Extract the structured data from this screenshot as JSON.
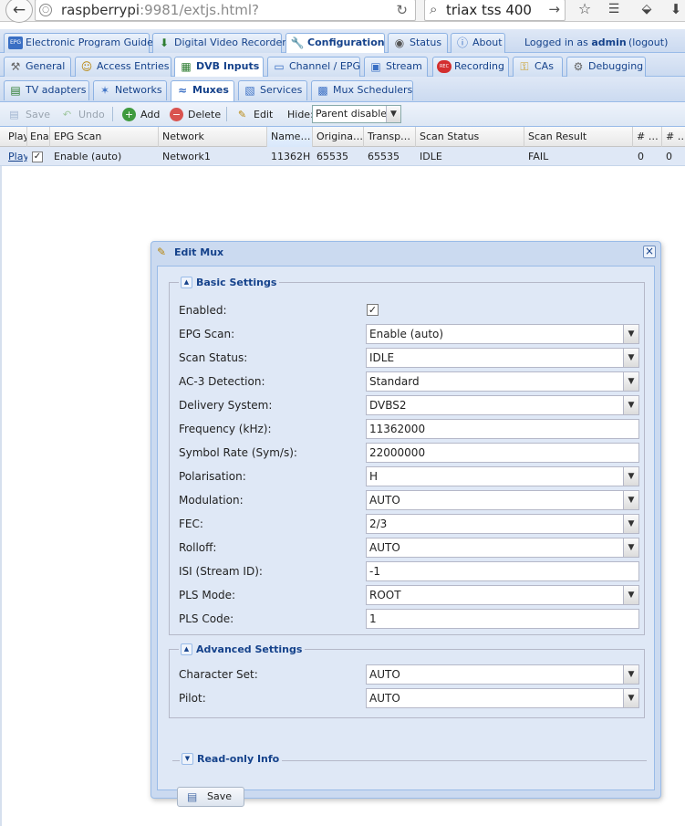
{
  "browser": {
    "url_host": "raspberrypi",
    "url_rest": ":9981/extjs.html?",
    "search_text": "triax tss 400"
  },
  "main_tabs": [
    {
      "label": "Electronic Program Guide",
      "icon": "epg-icon"
    },
    {
      "label": "Digital Video Recorder",
      "icon": "dvr-icon"
    },
    {
      "label": "Configuration",
      "icon": "wrench-icon",
      "active": true
    },
    {
      "label": "Status",
      "icon": "eye-icon"
    },
    {
      "label": "About",
      "icon": "info-icon"
    }
  ],
  "user": {
    "logged_in_prefix": "Logged in as",
    "username": "admin",
    "logout": "(logout)"
  },
  "config_tabs": [
    {
      "label": "General",
      "icon": "tools-icon"
    },
    {
      "label": "Access Entries",
      "icon": "users-icon"
    },
    {
      "label": "DVB Inputs",
      "icon": "card-icon",
      "active": true
    },
    {
      "label": "Channel / EPG",
      "icon": "tv-icon"
    },
    {
      "label": "Stream",
      "icon": "stream-icon"
    },
    {
      "label": "Recording",
      "icon": "rec-icon"
    },
    {
      "label": "CAs",
      "icon": "key-icon"
    },
    {
      "label": "Debugging",
      "icon": "debug-icon"
    }
  ],
  "dvb_tabs": [
    {
      "label": "TV adapters",
      "icon": "adapter-icon"
    },
    {
      "label": "Networks",
      "icon": "antenna-icon"
    },
    {
      "label": "Muxes",
      "icon": "mux-icon",
      "active": true
    },
    {
      "label": "Services",
      "icon": "services-icon"
    },
    {
      "label": "Mux Schedulers",
      "icon": "scheduler-icon"
    }
  ],
  "toolbar": {
    "save": "Save",
    "undo": "Undo",
    "add": "Add",
    "delete": "Delete",
    "edit": "Edit",
    "hide_label": "Hide:",
    "hide_value": "Parent disabled"
  },
  "grid": {
    "columns": [
      "Play",
      "Ena",
      "EPG Scan",
      "Network",
      "Name…",
      "Origina…",
      "Transp…",
      "Scan Status",
      "Scan Result",
      "# …",
      "# …"
    ],
    "row": {
      "play": "Play",
      "enabled": true,
      "epg_scan": "Enable (auto)",
      "network": "Network1",
      "name": "11362H",
      "original": "65535",
      "transport": "65535",
      "scan_status": "IDLE",
      "scan_result": "FAIL",
      "count1": "0",
      "count2": "0"
    }
  },
  "dialog": {
    "title": "Edit Mux",
    "basic_legend": "Basic Settings",
    "advanced_legend": "Advanced Settings",
    "readonly_legend": "Read-only Info",
    "save": "Save",
    "basic": [
      {
        "label": "Enabled:",
        "type": "checkbox",
        "checked": true
      },
      {
        "label": "EPG Scan:",
        "type": "combo",
        "value": "Enable (auto)"
      },
      {
        "label": "Scan Status:",
        "type": "combo",
        "value": "IDLE"
      },
      {
        "label": "AC-3 Detection:",
        "type": "combo",
        "value": "Standard"
      },
      {
        "label": "Delivery System:",
        "type": "combo",
        "value": "DVBS2"
      },
      {
        "label": "Frequency (kHz):",
        "type": "text",
        "value": "11362000"
      },
      {
        "label": "Symbol Rate (Sym/s):",
        "type": "text",
        "value": "22000000"
      },
      {
        "label": "Polarisation:",
        "type": "combo",
        "value": "H"
      },
      {
        "label": "Modulation:",
        "type": "combo",
        "value": "AUTO"
      },
      {
        "label": "FEC:",
        "type": "combo",
        "value": "2/3"
      },
      {
        "label": "Rolloff:",
        "type": "combo",
        "value": "AUTO"
      },
      {
        "label": "ISI (Stream ID):",
        "type": "text",
        "value": "-1"
      },
      {
        "label": "PLS Mode:",
        "type": "combo",
        "value": "ROOT"
      },
      {
        "label": "PLS Code:",
        "type": "text",
        "value": "1"
      }
    ],
    "advanced": [
      {
        "label": "Character Set:",
        "type": "combo",
        "value": "AUTO"
      },
      {
        "label": "Pilot:",
        "type": "combo",
        "value": "AUTO"
      }
    ]
  }
}
